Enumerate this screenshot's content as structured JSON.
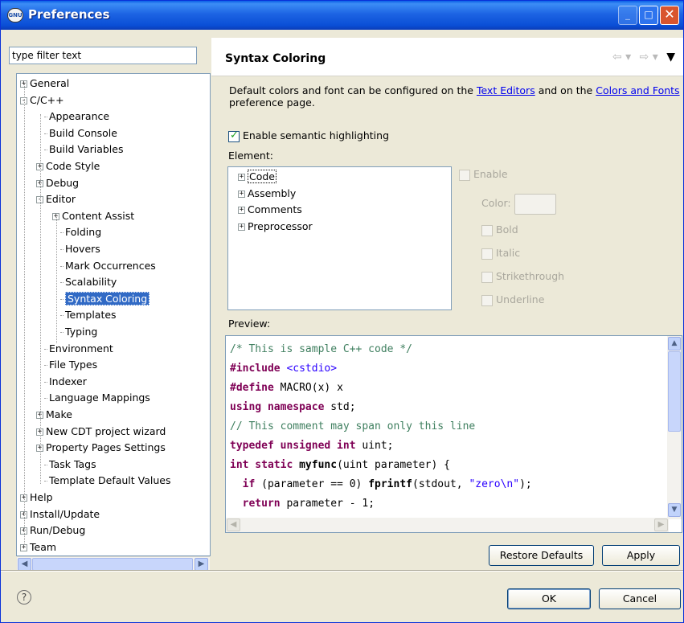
{
  "window": {
    "title": "Preferences",
    "icon": "eclipse-gnu-icon",
    "icon_text": "GNU"
  },
  "filter": {
    "placeholder": "type filter text",
    "value": "type filter text"
  },
  "tree": [
    {
      "label": "General",
      "toggle": "+"
    },
    {
      "label": "C/C++",
      "toggle": "-"
    },
    {
      "label": "Appearance"
    },
    {
      "label": "Build Console"
    },
    {
      "label": "Build Variables"
    },
    {
      "label": "Code Style",
      "toggle": "+"
    },
    {
      "label": "Debug",
      "toggle": "+"
    },
    {
      "label": "Editor",
      "toggle": "-"
    },
    {
      "label": "Content Assist",
      "toggle": "+"
    },
    {
      "label": "Folding"
    },
    {
      "label": "Hovers"
    },
    {
      "label": "Mark Occurrences"
    },
    {
      "label": "Scalability"
    },
    {
      "label": "Syntax Coloring",
      "selected": true
    },
    {
      "label": "Templates"
    },
    {
      "label": "Typing"
    },
    {
      "label": "Environment"
    },
    {
      "label": "File Types"
    },
    {
      "label": "Indexer"
    },
    {
      "label": "Language Mappings"
    },
    {
      "label": "Make",
      "toggle": "+"
    },
    {
      "label": "New CDT project wizard",
      "toggle": "+"
    },
    {
      "label": "Property Pages Settings",
      "toggle": "+"
    },
    {
      "label": "Task Tags"
    },
    {
      "label": "Template Default Values"
    },
    {
      "label": "Help",
      "toggle": "+"
    },
    {
      "label": "Install/Update",
      "toggle": "+"
    },
    {
      "label": "Run/Debug",
      "toggle": "+"
    },
    {
      "label": "Team",
      "toggle": "+"
    }
  ],
  "page": {
    "title": "Syntax Coloring",
    "nav": {
      "back": "⇦",
      "forward": "⇨",
      "dropdown": "▾",
      "menu": "▼"
    },
    "description": {
      "before": "Default colors and font can be configured on the ",
      "link1": "Text Editors",
      "middle": " and on the ",
      "link2": "Colors and Fonts",
      "after": " preference page."
    },
    "semantic_label": "Enable semantic highlighting",
    "element_label": "Element:",
    "elements": [
      "Code",
      "Assembly",
      "Comments",
      "Preprocessor"
    ],
    "enable_label": "Enable",
    "color_label": "Color:",
    "styles": [
      "Bold",
      "Italic",
      "Strikethrough",
      "Underline"
    ],
    "preview_label": "Preview:"
  },
  "buttons": {
    "restore": "Restore Defaults",
    "apply": "Apply",
    "ok": "OK",
    "cancel": "Cancel"
  },
  "help": "?"
}
